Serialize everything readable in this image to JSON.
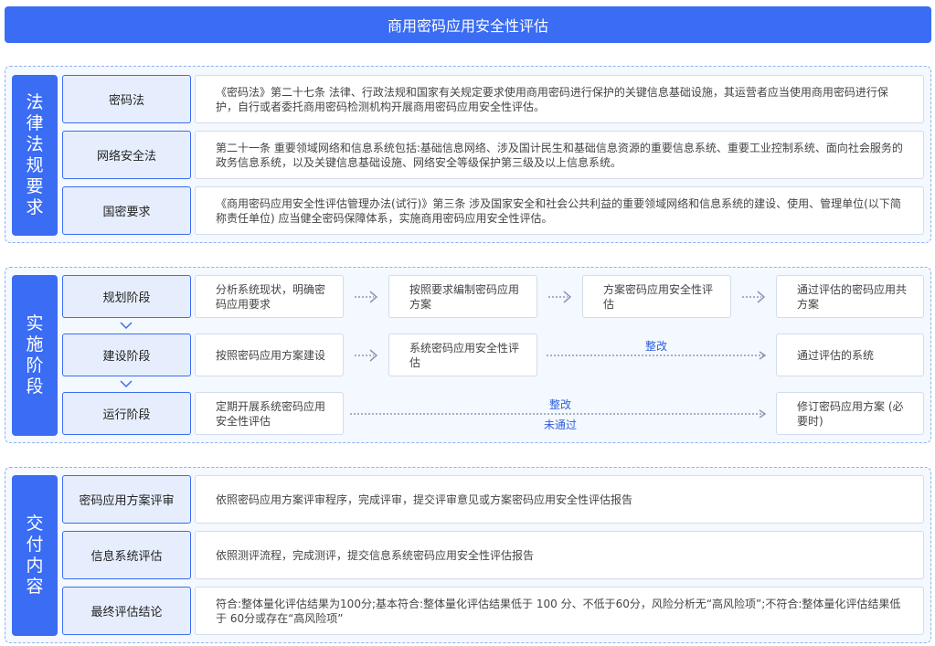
{
  "title": "商用密码应用安全性评估",
  "legal": {
    "label": "法律法规要求",
    "rows": [
      {
        "name": "密码法",
        "desc": "《密码法》第二十七条 法律、行政法规和国家有关规定要求使用商用密码进行保护的关键信息基础设施，其运营者应当使用商用密码进行保护，自行或者委托商用密码检测机构开展商用密码应用安全性评估。"
      },
      {
        "name": "网络安全法",
        "desc": "第二十一条 重要领域网络和信息系统包括:基础信息网络、涉及国计民生和基础信息资源的重要信息系统、重要工业控制系统、面向社会服务的政务信息系统，以及关键信息基础设施、网络安全等级保护第三级及以上信息系统。"
      },
      {
        "name": "国密要求",
        "desc": "《商用密码应用安全性评估管理办法(试行)》第三条 涉及国家安全和社会公共利益的重要领域网络和信息系统的建设、使用、管理单位(以下简称责任单位) 应当健全密码保障体系，实施商用密码应用安全性评估。"
      }
    ]
  },
  "impl": {
    "label": "实施阶段",
    "stages": [
      {
        "name": "规划阶段",
        "steps": [
          "分析系统现状，明确密码应用要求",
          "按照要求编制密码应用方案",
          "方案密码应用安全性评估",
          "通过评估的密码应用共方案"
        ]
      },
      {
        "name": "建设阶段",
        "steps": [
          "按照密码应用方案建设",
          "系统密码应用安全性评估",
          "通过评估的系统"
        ],
        "line_label": "整改"
      },
      {
        "name": "运行阶段",
        "steps": [
          "定期开展系统密码应用安全性评估",
          "修订密码应用方案 (必要时)"
        ],
        "line_label_top": "整改",
        "line_label_bottom": "未通过"
      }
    ]
  },
  "deliver": {
    "label": "交付内容",
    "rows": [
      {
        "name": "密码应用方案评审",
        "desc": "依照密码应用方案评审程序，完成评审，提交评审意见或方案密码应用安全性评估报告"
      },
      {
        "name": "信息系统评估",
        "desc": "依照测评流程，完成测评，提交信息系统密码应用安全性评估报告"
      },
      {
        "name": "最终评估结论",
        "desc": "符合:整体量化评估结果为100分;基本符合:整体量化评估结果低于 100 分、不低于60分，风险分析无“高风险项”;不符合:整体量化评估结果低于 60分或存在“高风险项”"
      }
    ]
  },
  "colors": {
    "accent": "#3a6cf4",
    "label_bg": "#e6eefd",
    "section_bg": "#f4f8ff"
  },
  "icons": {
    "step_arrow": "dotted-arrow-right-icon",
    "stage_arrow": "chevron-down-icon"
  }
}
